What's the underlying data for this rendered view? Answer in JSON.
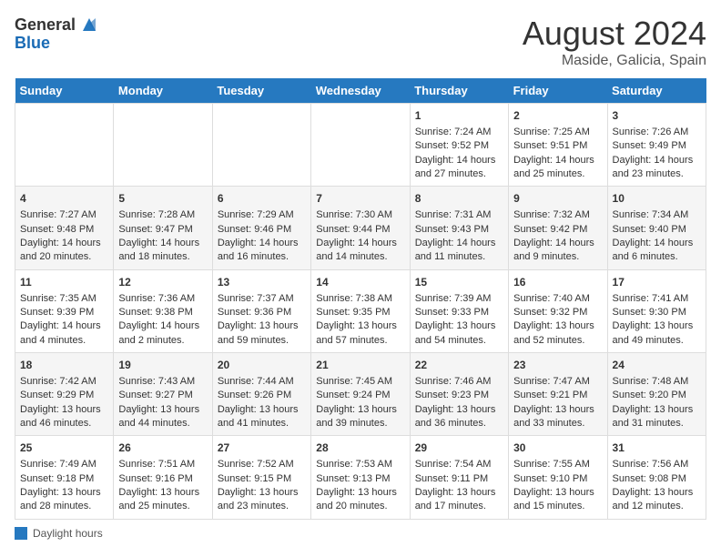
{
  "header": {
    "logo_general": "General",
    "logo_blue": "Blue",
    "month_year": "August 2024",
    "location": "Maside, Galicia, Spain"
  },
  "days_of_week": [
    "Sunday",
    "Monday",
    "Tuesday",
    "Wednesday",
    "Thursday",
    "Friday",
    "Saturday"
  ],
  "legend": {
    "label": "Daylight hours"
  },
  "weeks": [
    {
      "days": [
        {
          "num": "",
          "sunrise": "",
          "sunset": "",
          "daylight": ""
        },
        {
          "num": "",
          "sunrise": "",
          "sunset": "",
          "daylight": ""
        },
        {
          "num": "",
          "sunrise": "",
          "sunset": "",
          "daylight": ""
        },
        {
          "num": "",
          "sunrise": "",
          "sunset": "",
          "daylight": ""
        },
        {
          "num": "1",
          "sunrise": "Sunrise: 7:24 AM",
          "sunset": "Sunset: 9:52 PM",
          "daylight": "Daylight: 14 hours and 27 minutes."
        },
        {
          "num": "2",
          "sunrise": "Sunrise: 7:25 AM",
          "sunset": "Sunset: 9:51 PM",
          "daylight": "Daylight: 14 hours and 25 minutes."
        },
        {
          "num": "3",
          "sunrise": "Sunrise: 7:26 AM",
          "sunset": "Sunset: 9:49 PM",
          "daylight": "Daylight: 14 hours and 23 minutes."
        }
      ]
    },
    {
      "days": [
        {
          "num": "4",
          "sunrise": "Sunrise: 7:27 AM",
          "sunset": "Sunset: 9:48 PM",
          "daylight": "Daylight: 14 hours and 20 minutes."
        },
        {
          "num": "5",
          "sunrise": "Sunrise: 7:28 AM",
          "sunset": "Sunset: 9:47 PM",
          "daylight": "Daylight: 14 hours and 18 minutes."
        },
        {
          "num": "6",
          "sunrise": "Sunrise: 7:29 AM",
          "sunset": "Sunset: 9:46 PM",
          "daylight": "Daylight: 14 hours and 16 minutes."
        },
        {
          "num": "7",
          "sunrise": "Sunrise: 7:30 AM",
          "sunset": "Sunset: 9:44 PM",
          "daylight": "Daylight: 14 hours and 14 minutes."
        },
        {
          "num": "8",
          "sunrise": "Sunrise: 7:31 AM",
          "sunset": "Sunset: 9:43 PM",
          "daylight": "Daylight: 14 hours and 11 minutes."
        },
        {
          "num": "9",
          "sunrise": "Sunrise: 7:32 AM",
          "sunset": "Sunset: 9:42 PM",
          "daylight": "Daylight: 14 hours and 9 minutes."
        },
        {
          "num": "10",
          "sunrise": "Sunrise: 7:34 AM",
          "sunset": "Sunset: 9:40 PM",
          "daylight": "Daylight: 14 hours and 6 minutes."
        }
      ]
    },
    {
      "days": [
        {
          "num": "11",
          "sunrise": "Sunrise: 7:35 AM",
          "sunset": "Sunset: 9:39 PM",
          "daylight": "Daylight: 14 hours and 4 minutes."
        },
        {
          "num": "12",
          "sunrise": "Sunrise: 7:36 AM",
          "sunset": "Sunset: 9:38 PM",
          "daylight": "Daylight: 14 hours and 2 minutes."
        },
        {
          "num": "13",
          "sunrise": "Sunrise: 7:37 AM",
          "sunset": "Sunset: 9:36 PM",
          "daylight": "Daylight: 13 hours and 59 minutes."
        },
        {
          "num": "14",
          "sunrise": "Sunrise: 7:38 AM",
          "sunset": "Sunset: 9:35 PM",
          "daylight": "Daylight: 13 hours and 57 minutes."
        },
        {
          "num": "15",
          "sunrise": "Sunrise: 7:39 AM",
          "sunset": "Sunset: 9:33 PM",
          "daylight": "Daylight: 13 hours and 54 minutes."
        },
        {
          "num": "16",
          "sunrise": "Sunrise: 7:40 AM",
          "sunset": "Sunset: 9:32 PM",
          "daylight": "Daylight: 13 hours and 52 minutes."
        },
        {
          "num": "17",
          "sunrise": "Sunrise: 7:41 AM",
          "sunset": "Sunset: 9:30 PM",
          "daylight": "Daylight: 13 hours and 49 minutes."
        }
      ]
    },
    {
      "days": [
        {
          "num": "18",
          "sunrise": "Sunrise: 7:42 AM",
          "sunset": "Sunset: 9:29 PM",
          "daylight": "Daylight: 13 hours and 46 minutes."
        },
        {
          "num": "19",
          "sunrise": "Sunrise: 7:43 AM",
          "sunset": "Sunset: 9:27 PM",
          "daylight": "Daylight: 13 hours and 44 minutes."
        },
        {
          "num": "20",
          "sunrise": "Sunrise: 7:44 AM",
          "sunset": "Sunset: 9:26 PM",
          "daylight": "Daylight: 13 hours and 41 minutes."
        },
        {
          "num": "21",
          "sunrise": "Sunrise: 7:45 AM",
          "sunset": "Sunset: 9:24 PM",
          "daylight": "Daylight: 13 hours and 39 minutes."
        },
        {
          "num": "22",
          "sunrise": "Sunrise: 7:46 AM",
          "sunset": "Sunset: 9:23 PM",
          "daylight": "Daylight: 13 hours and 36 minutes."
        },
        {
          "num": "23",
          "sunrise": "Sunrise: 7:47 AM",
          "sunset": "Sunset: 9:21 PM",
          "daylight": "Daylight: 13 hours and 33 minutes."
        },
        {
          "num": "24",
          "sunrise": "Sunrise: 7:48 AM",
          "sunset": "Sunset: 9:20 PM",
          "daylight": "Daylight: 13 hours and 31 minutes."
        }
      ]
    },
    {
      "days": [
        {
          "num": "25",
          "sunrise": "Sunrise: 7:49 AM",
          "sunset": "Sunset: 9:18 PM",
          "daylight": "Daylight: 13 hours and 28 minutes."
        },
        {
          "num": "26",
          "sunrise": "Sunrise: 7:51 AM",
          "sunset": "Sunset: 9:16 PM",
          "daylight": "Daylight: 13 hours and 25 minutes."
        },
        {
          "num": "27",
          "sunrise": "Sunrise: 7:52 AM",
          "sunset": "Sunset: 9:15 PM",
          "daylight": "Daylight: 13 hours and 23 minutes."
        },
        {
          "num": "28",
          "sunrise": "Sunrise: 7:53 AM",
          "sunset": "Sunset: 9:13 PM",
          "daylight": "Daylight: 13 hours and 20 minutes."
        },
        {
          "num": "29",
          "sunrise": "Sunrise: 7:54 AM",
          "sunset": "Sunset: 9:11 PM",
          "daylight": "Daylight: 13 hours and 17 minutes."
        },
        {
          "num": "30",
          "sunrise": "Sunrise: 7:55 AM",
          "sunset": "Sunset: 9:10 PM",
          "daylight": "Daylight: 13 hours and 15 minutes."
        },
        {
          "num": "31",
          "sunrise": "Sunrise: 7:56 AM",
          "sunset": "Sunset: 9:08 PM",
          "daylight": "Daylight: 13 hours and 12 minutes."
        }
      ]
    }
  ]
}
